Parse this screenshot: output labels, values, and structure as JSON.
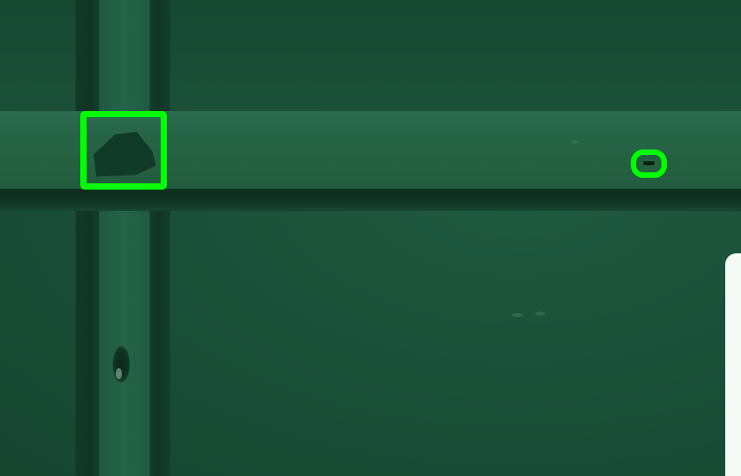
{
  "scene": {
    "subject": "pcb-inspection-closeup",
    "board_color": "#1a5039",
    "trace_color": "#276548",
    "gap_color": "#0f3525",
    "pad_color": "#f4fbf7"
  },
  "detections": [
    {
      "label": "",
      "color": "#00ff00"
    },
    {
      "label": "",
      "color": "#00ff00"
    }
  ]
}
